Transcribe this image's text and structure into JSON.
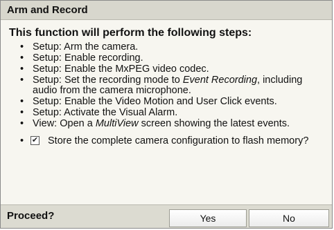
{
  "dialog": {
    "title": "Arm and Record",
    "heading": "This function will perform the following steps:",
    "steps": [
      {
        "text": "Setup: Arm the camera."
      },
      {
        "text": "Setup: Enable recording."
      },
      {
        "text": "Setup: Enable the MxPEG video codec."
      },
      {
        "pre": "Setup: Set the recording mode to ",
        "em": "Event Recording",
        "post": ", including audio from the camera microphone."
      },
      {
        "text": "Setup: Enable the Video Motion and User Click events."
      },
      {
        "text": "Setup: Activate the Visual Alarm."
      },
      {
        "pre": "View: Open a ",
        "em": "MultiView",
        "post": " screen showing the latest events."
      }
    ],
    "store_option": {
      "label": "Store the complete camera configuration to flash memory?",
      "checked": true,
      "check_glyph": "✔"
    },
    "bullet": "•",
    "footer": {
      "proceed_label": "Proceed?",
      "yes_label": "Yes",
      "no_label": "No"
    }
  }
}
